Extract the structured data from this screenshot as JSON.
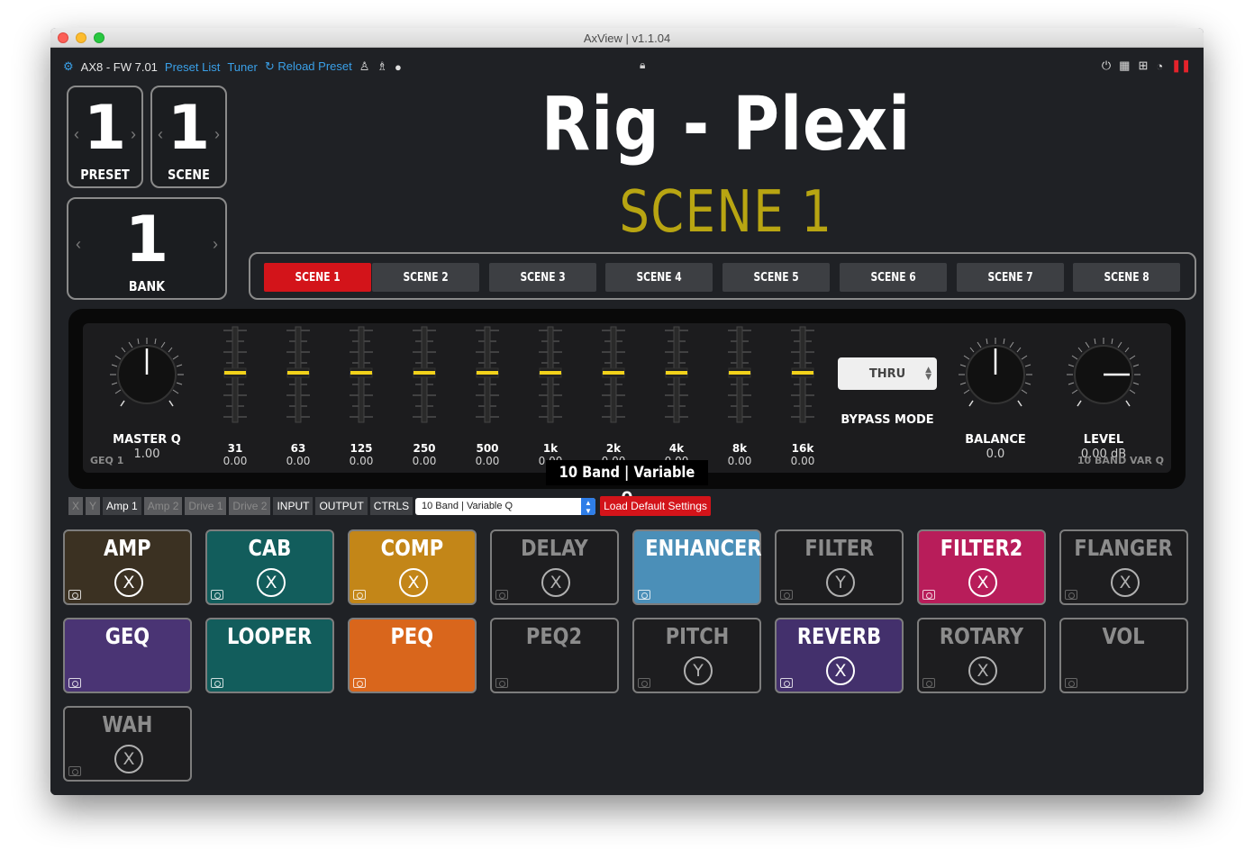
{
  "window": {
    "title": "AxView | v1.1.04"
  },
  "nav": {
    "device": "AX8 - FW 7.01",
    "preset_list": "Preset List",
    "tuner": "Tuner",
    "reload_preset": "Reload Preset",
    "left_icons": [
      "metronome-icon",
      "tuner-fork-icon",
      "midi-icon"
    ],
    "right_icons": [
      "power-icon",
      "calendar-icon",
      "network-icon",
      "speedometer-icon",
      "pause-icon"
    ]
  },
  "selectors": {
    "preset": {
      "number": "1",
      "label": "PRESET"
    },
    "scene": {
      "number": "1",
      "label": "SCENE"
    },
    "bank": {
      "number": "1",
      "label": "BANK"
    }
  },
  "header": {
    "title": "Rig - Plexi",
    "subtitle": "SCENE 1"
  },
  "scenes": [
    {
      "label": "SCENE 1",
      "active": true
    },
    {
      "label": "SCENE 2",
      "active": false
    },
    {
      "label": "SCENE 3",
      "active": false
    },
    {
      "label": "SCENE 4",
      "active": false
    },
    {
      "label": "SCENE 5",
      "active": false
    },
    {
      "label": "SCENE 6",
      "active": false
    },
    {
      "label": "SCENE 7",
      "active": false
    },
    {
      "label": "SCENE 8",
      "active": false
    }
  ],
  "effect": {
    "name": "10 Band | Variable Q",
    "block_id": "GEQ 1",
    "type_label": "10 BAND VAR Q",
    "master_q": {
      "label": "MASTER Q",
      "value": "1.00"
    },
    "bands": [
      {
        "freq": "31",
        "value": "0.00"
      },
      {
        "freq": "63",
        "value": "0.00"
      },
      {
        "freq": "125",
        "value": "0.00"
      },
      {
        "freq": "250",
        "value": "0.00"
      },
      {
        "freq": "500",
        "value": "0.00"
      },
      {
        "freq": "1k",
        "value": "0.00"
      },
      {
        "freq": "2k",
        "value": "0.00"
      },
      {
        "freq": "4k",
        "value": "0.00"
      },
      {
        "freq": "8k",
        "value": "0.00"
      },
      {
        "freq": "16k",
        "value": "0.00"
      }
    ],
    "bypass_mode": {
      "value": "THRU",
      "label": "BYPASS MODE"
    },
    "balance": {
      "label": "BALANCE",
      "value": "0.0"
    },
    "level": {
      "label": "LEVEL",
      "value": "0.00 dB"
    },
    "slider_accent": "#f2d21a"
  },
  "tabs": {
    "x": "X",
    "y": "Y",
    "items": [
      "Amp 1",
      "Amp 2",
      "Drive 1",
      "Drive 2"
    ],
    "input": "INPUT",
    "output": "OUTPUT",
    "ctrls": "CTRLS",
    "type_select": "10 Band | Variable Q",
    "load_default": "Load Default Settings"
  },
  "blocks": [
    {
      "name": "AMP",
      "state": "X",
      "bg": "#3b3122"
    },
    {
      "name": "CAB",
      "state": "X",
      "bg": "#125d5c"
    },
    {
      "name": "COMP",
      "state": "X",
      "bg": "#c38618"
    },
    {
      "name": "DELAY",
      "state": "X",
      "bg": ""
    },
    {
      "name": "ENHANCER",
      "state": "",
      "bg": "#4b8fb8"
    },
    {
      "name": "FILTER",
      "state": "Y",
      "bg": ""
    },
    {
      "name": "FILTER2",
      "state": "X",
      "bg": "#b81d5a"
    },
    {
      "name": "FLANGER",
      "state": "X",
      "bg": ""
    },
    {
      "name": "GEQ",
      "state": "",
      "bg": "#4a3474"
    },
    {
      "name": "LOOPER",
      "state": "",
      "bg": "#125d5c"
    },
    {
      "name": "PEQ",
      "state": "",
      "bg": "#d9661c"
    },
    {
      "name": "PEQ2",
      "state": "",
      "bg": ""
    },
    {
      "name": "PITCH",
      "state": "Y",
      "bg": ""
    },
    {
      "name": "REVERB",
      "state": "X",
      "bg": "#43306c"
    },
    {
      "name": "ROTARY",
      "state": "X",
      "bg": ""
    },
    {
      "name": "VOL",
      "state": "",
      "bg": ""
    },
    {
      "name": "WAH",
      "state": "X",
      "bg": ""
    }
  ]
}
